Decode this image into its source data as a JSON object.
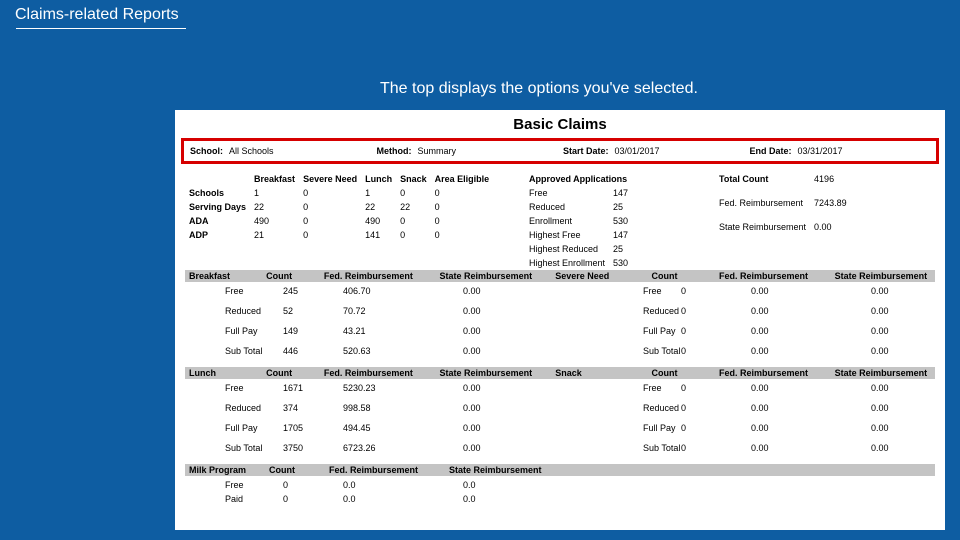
{
  "header": {
    "title": "Claims-related Reports"
  },
  "annotation": "The top displays the options you've selected.",
  "report_title": "Basic Claims",
  "params": {
    "school_label": "School:",
    "school_value": "All Schools",
    "method_label": "Method:",
    "method_value": "Summary",
    "start_label": "Start Date:",
    "start_value": "03/01/2017",
    "end_label": "End Date:",
    "end_value": "03/31/2017"
  },
  "summary_cols": {
    "breakfast": "Breakfast",
    "severe_need": "Severe Need",
    "lunch": "Lunch",
    "snack": "Snack",
    "area_eligible": "Area Eligible"
  },
  "summary_rows": [
    {
      "label": "Schools",
      "b": "1",
      "sn": "0",
      "l": "1",
      "s": "0",
      "ae": "0"
    },
    {
      "label": "Serving Days",
      "b": "22",
      "sn": "0",
      "l": "22",
      "s": "22",
      "ae": "0"
    },
    {
      "label": "ADA",
      "b": "490",
      "sn": "0",
      "l": "490",
      "s": "0",
      "ae": "0"
    },
    {
      "label": "ADP",
      "b": "21",
      "sn": "0",
      "l": "141",
      "s": "0",
      "ae": "0"
    }
  ],
  "approved_apps_header": "Approved Applications",
  "approved_apps": [
    {
      "label": "Free",
      "value": "147"
    },
    {
      "label": "Reduced",
      "value": "25"
    },
    {
      "label": "Enrollment",
      "value": "530"
    },
    {
      "label": "Highest Free",
      "value": "147"
    },
    {
      "label": "Highest Reduced",
      "value": "25"
    },
    {
      "label": "Highest Enrollment",
      "value": "530"
    }
  ],
  "totals_header": "Total Count",
  "total_count": "4196",
  "reimb": [
    {
      "label": "Fed. Reimbursement",
      "value": "7243.89"
    },
    {
      "label": "State Reimbursement",
      "value": "0.00"
    }
  ],
  "det_headers": {
    "count": "Count",
    "fed": "Fed. Reimbursement",
    "state": "State Reimbursement"
  },
  "sections": [
    {
      "left": {
        "title": "Breakfast",
        "rows": [
          {
            "label": "Free",
            "count": "245",
            "fed": "406.70",
            "state": "0.00"
          },
          {
            "label": "Reduced",
            "count": "52",
            "fed": "70.72",
            "state": "0.00"
          },
          {
            "label": "Full Pay",
            "count": "149",
            "fed": "43.21",
            "state": "0.00"
          },
          {
            "label": "Sub Total",
            "count": "446",
            "fed": "520.63",
            "state": "0.00"
          }
        ]
      },
      "right": {
        "title": "Severe Need",
        "rows": [
          {
            "label": "Free",
            "count": "0",
            "fed": "0.00",
            "state": "0.00"
          },
          {
            "label": "Reduced",
            "count": "0",
            "fed": "0.00",
            "state": "0.00"
          },
          {
            "label": "Full Pay",
            "count": "0",
            "fed": "0.00",
            "state": "0.00"
          },
          {
            "label": "Sub Total",
            "count": "0",
            "fed": "0.00",
            "state": "0.00"
          }
        ]
      }
    },
    {
      "left": {
        "title": "Lunch",
        "rows": [
          {
            "label": "Free",
            "count": "1671",
            "fed": "5230.23",
            "state": "0.00"
          },
          {
            "label": "Reduced",
            "count": "374",
            "fed": "998.58",
            "state": "0.00"
          },
          {
            "label": "Full Pay",
            "count": "1705",
            "fed": "494.45",
            "state": "0.00"
          },
          {
            "label": "Sub Total",
            "count": "3750",
            "fed": "6723.26",
            "state": "0.00"
          }
        ]
      },
      "right": {
        "title": "Snack",
        "rows": [
          {
            "label": "Free",
            "count": "0",
            "fed": "0.00",
            "state": "0.00"
          },
          {
            "label": "Reduced",
            "count": "0",
            "fed": "0.00",
            "state": "0.00"
          },
          {
            "label": "Full Pay",
            "count": "0",
            "fed": "0.00",
            "state": "0.00"
          },
          {
            "label": "Sub Total",
            "count": "0",
            "fed": "0.00",
            "state": "0.00"
          }
        ]
      }
    },
    {
      "left": {
        "title": "Milk Program",
        "rows": [
          {
            "label": "Free",
            "count": "0",
            "fed": "0.0",
            "state": "0.0"
          },
          {
            "label": "Paid",
            "count": "0",
            "fed": "0.0",
            "state": "0.0"
          }
        ]
      },
      "right": null
    }
  ]
}
